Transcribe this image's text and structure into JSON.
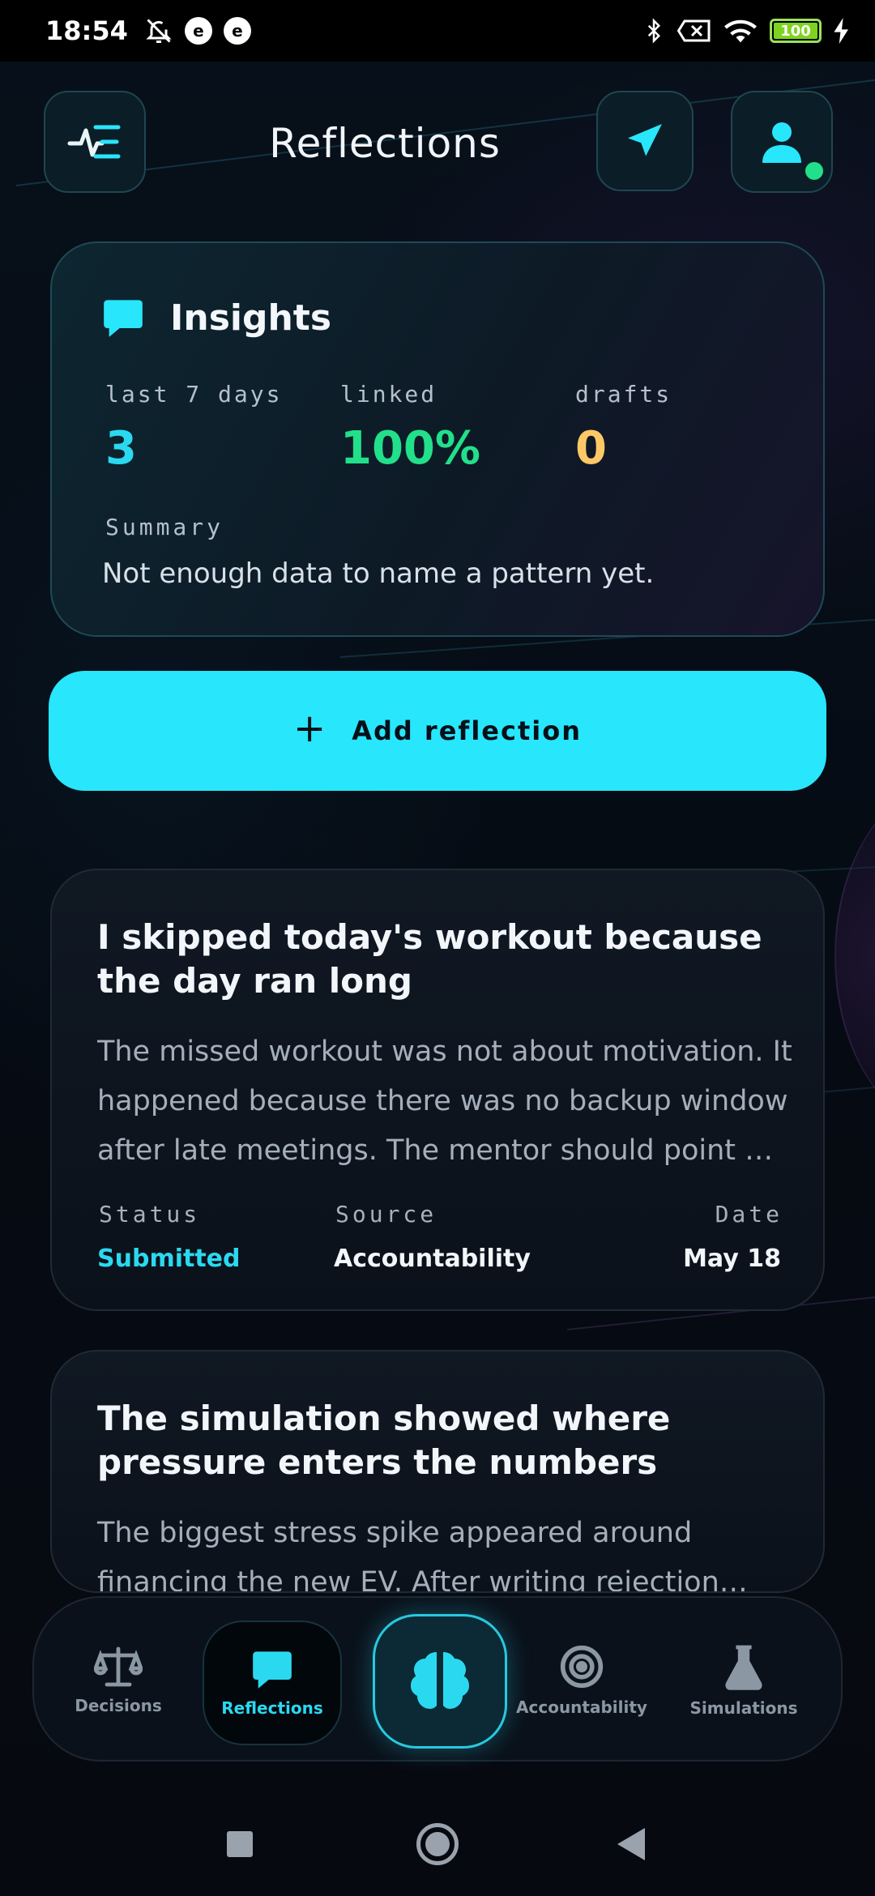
{
  "status_bar": {
    "time": "18:54",
    "battery": "100"
  },
  "header": {
    "title": "Reflections"
  },
  "insights": {
    "title": "Insights",
    "stats": [
      {
        "label": "last 7 days",
        "value": "3",
        "color": "#2ad9f0"
      },
      {
        "label": "linked",
        "value": "100%",
        "color": "#22e08a"
      },
      {
        "label": "drafts",
        "value": "0",
        "color": "#ffc866"
      }
    ],
    "summary_label": "Summary",
    "summary_text": "Not enough data to name a pattern yet."
  },
  "add_button": {
    "label": "Add reflection"
  },
  "reflections": [
    {
      "title": "I skipped today's workout because the day ran long",
      "body": "The missed workout was not about motivation. It happened because there was no backup window after late meetings. The mentor should point …",
      "status_label": "Status",
      "status": "Submitted",
      "source_label": "Source",
      "source": "Accountability",
      "date_label": "Date",
      "date": "May 18"
    },
    {
      "title": "The simulation showed where pressure enters the numbers",
      "body": "The biggest stress spike appeared around financing the new EV. After writing rejection…"
    }
  ],
  "nav": {
    "items": [
      {
        "label": "Decisions"
      },
      {
        "label": "Reflections"
      },
      {
        "label": "Accountability"
      },
      {
        "label": "Simulations"
      }
    ]
  },
  "colors": {
    "accent": "#28e6fc",
    "green": "#22e08a",
    "amber": "#ffc866"
  }
}
